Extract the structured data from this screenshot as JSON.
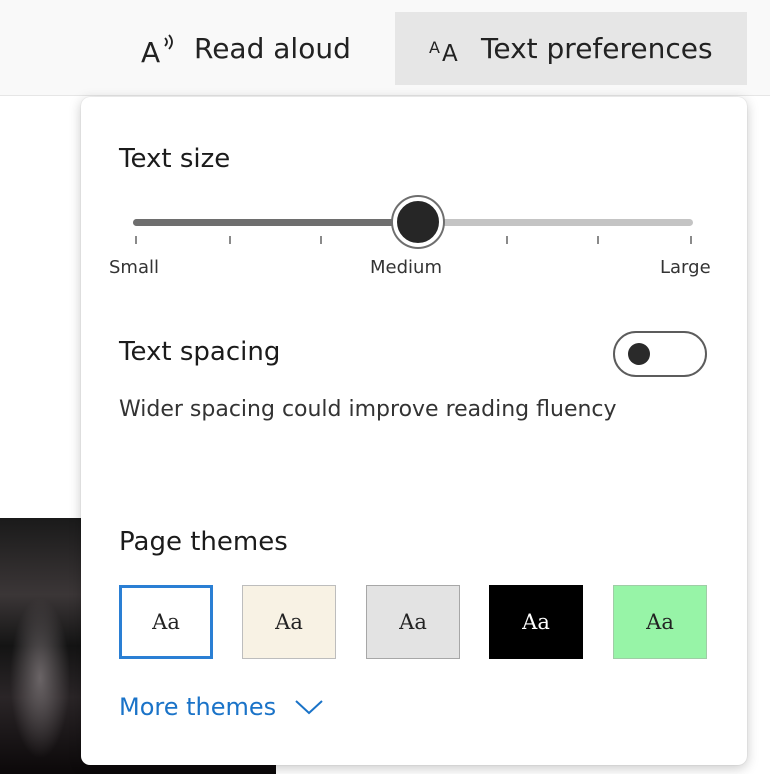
{
  "toolbar": {
    "read_aloud_label": "Read aloud",
    "text_preferences_label": "Text preferences"
  },
  "text_size": {
    "title": "Text size",
    "label_small": "Small",
    "label_medium": "Medium",
    "label_large": "Large",
    "value_fraction": 0.5
  },
  "text_spacing": {
    "title": "Text spacing",
    "description": "Wider spacing could improve reading fluency",
    "enabled": false
  },
  "page_themes": {
    "title": "Page themes",
    "themes": [
      {
        "label": "Aa",
        "background": "#ffffff",
        "selected": true
      },
      {
        "label": "Aa",
        "background": "#f8f2e4",
        "selected": false
      },
      {
        "label": "Aa",
        "background": "#e3e3e3",
        "selected": false
      },
      {
        "label": "Aa",
        "background": "#000000",
        "selected": false
      },
      {
        "label": "Aa",
        "background": "#97f4a7",
        "selected": false
      }
    ],
    "more_label": "More themes"
  },
  "colors": {
    "accent": "#1a73c8",
    "selected_border": "#2a7fd4"
  }
}
